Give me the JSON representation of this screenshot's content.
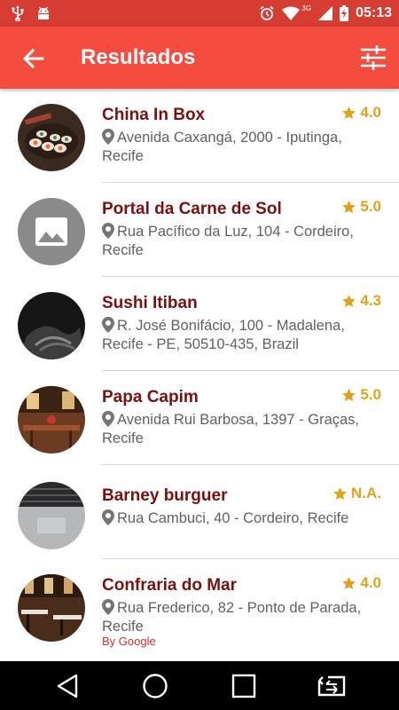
{
  "status_bar": {
    "time": "05:13",
    "network_label": "3G",
    "icons": [
      "usb-icon",
      "android-debug-icon",
      "alarm-icon",
      "wifi-icon",
      "cellular-signal-icon",
      "battery-charging-icon"
    ]
  },
  "app_bar": {
    "title": "Resultados",
    "back_icon": "arrow-left-icon",
    "filter_icon": "sliders-icon"
  },
  "colors": {
    "status_bar": "#d53c32",
    "app_bar": "#f44c3f",
    "name_text": "#7a1010",
    "rating_star": "#e2a117",
    "address_text": "#616161",
    "attribution": "#d32f2f"
  },
  "results": [
    {
      "name": "China In Box",
      "rating": "4.0",
      "address": "Avenida Caxangá, 2000 - Iputinga, Recife",
      "image": "sushi-photo"
    },
    {
      "name": "Portal da Carne de Sol",
      "rating": "5.0",
      "address": "Rua Pacífico da Luz, 104 - Cordeiro, Recife",
      "image": "placeholder-image-icon"
    },
    {
      "name": "Sushi Itiban",
      "rating": "4.3",
      "address": "R. José Bonifácio, 100 - Madalena, Recife - PE, 50510-435, Brazil",
      "image": "dark-photo"
    },
    {
      "name": "Papa Capim",
      "rating": "5.0",
      "address": "Avenida Rui Barbosa, 1397 - Graças, Recife",
      "image": "restaurant-interior-photo"
    },
    {
      "name": "Barney burguer",
      "rating": "N.A.",
      "address": "Rua Cambuci, 40 - Cordeiro, Recife",
      "image": "laptop-photo"
    },
    {
      "name": "Confraria do Mar",
      "rating": "4.0",
      "address": "Rua Frederico, 82 - Ponto de Parada, Recife",
      "image": "restaurant-tables-photo"
    }
  ],
  "attribution": "By Google",
  "nav_bar": {
    "icons": [
      "back-triangle-icon",
      "home-circle-icon",
      "recents-square-icon",
      "screen-cast-icon"
    ]
  }
}
